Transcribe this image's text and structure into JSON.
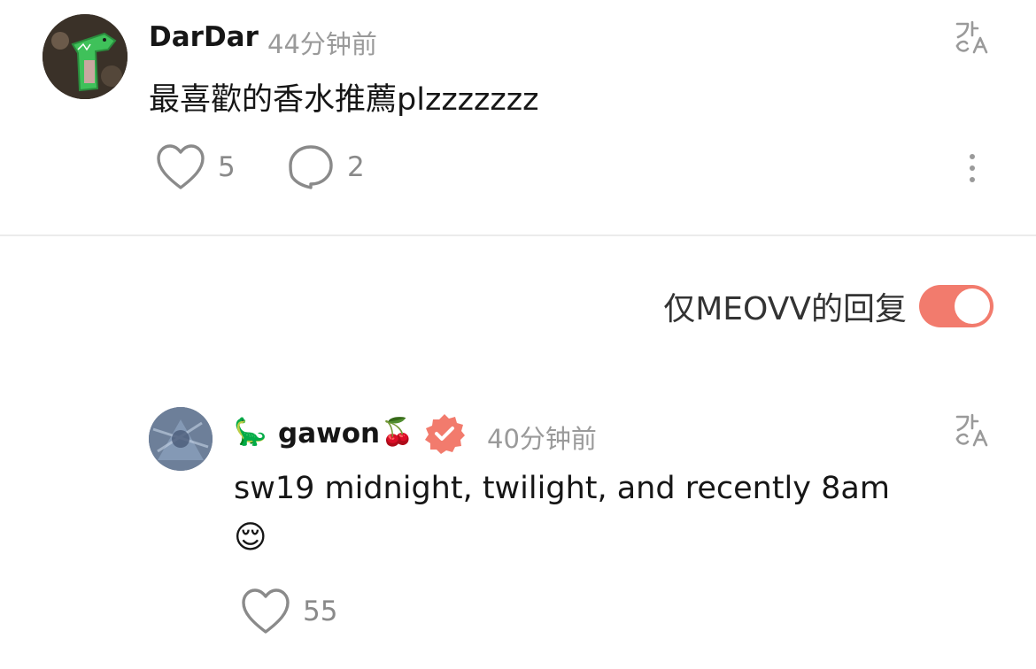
{
  "comment": {
    "username": "DarDar",
    "timestamp": "44分钟前",
    "text": "最喜歡的香水推薦plzzzzzzz",
    "likes": "5",
    "replies": "2",
    "icons": {
      "avatar": "avatar",
      "translate": "translate-icon",
      "like": "heart-icon",
      "reply": "comment-bubble-icon",
      "more": "more-vertical-icon"
    }
  },
  "filter": {
    "label": "仅MEOVV的回复",
    "enabled": true,
    "accent_color": "#f27b6d"
  },
  "reply": {
    "username": "gawon",
    "prefix_emoji": "🦕",
    "suffix_emoji": "🍒",
    "timestamp": "40分钟前",
    "text_line1": "sw19 midnight, twilight, and recently 8am",
    "text_emoji": "😌",
    "likes": "55",
    "verified_color": "#f27b6d"
  }
}
